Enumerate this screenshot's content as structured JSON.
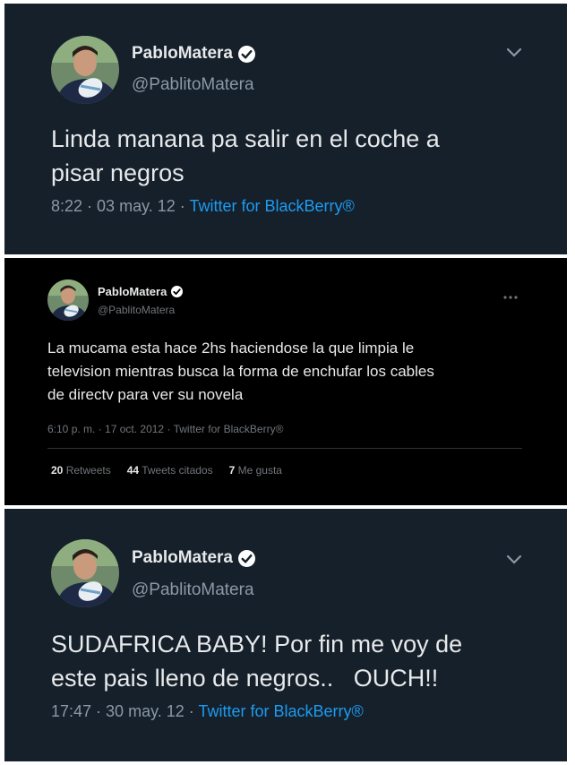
{
  "tweets": [
    {
      "display_name": "PabloMatera",
      "handle": "@PablitoMatera",
      "text": "Linda manana pa salir en el coche a\npisar negros",
      "time": "8:22",
      "date": "03 may. 12",
      "source": "Twitter for BlackBerry®",
      "verified_icon": "verified-badge-icon",
      "menu_icon": "chevron-down-icon"
    },
    {
      "display_name": "PabloMatera",
      "handle": "@PablitoMatera",
      "text": "La mucama esta hace 2hs haciendose la que limpia le\ntelevision mientras busca la forma de enchufar los cables\nde directv para ver su novela",
      "time": "6:10 p. m.",
      "date": "17 oct. 2012",
      "source": "Twitter for BlackBerry®",
      "verified_icon": "verified-badge-icon",
      "menu_icon": "more-dots-icon",
      "stats": {
        "retweets_count": "20",
        "retweets_label": "Retweets",
        "quotes_count": "44",
        "quotes_label": "Tweets citados",
        "likes_count": "7",
        "likes_label": "Me gusta"
      }
    },
    {
      "display_name": "PabloMatera",
      "handle": "@PablitoMatera",
      "text": "SUDAFRICA BABY! Por fin me voy de\neste pais lleno de negros..   OUCH!!",
      "time": "17:47",
      "date": "30 may. 12",
      "source": "Twitter for BlackBerry®",
      "verified_icon": "verified-badge-icon",
      "menu_icon": "chevron-down-icon"
    }
  ],
  "meta_separator": " · ",
  "colors": {
    "dim_bg": "#15202b",
    "black_bg": "#000000",
    "link_blue": "#1d9bf0"
  }
}
